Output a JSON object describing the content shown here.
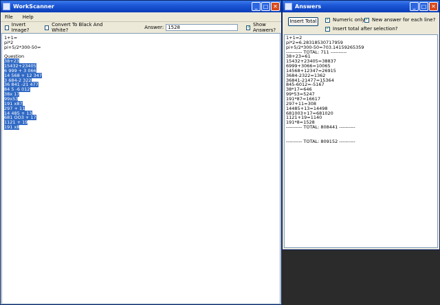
{
  "left_window": {
    "title": "WorkScanner",
    "menu": [
      "File",
      "Help"
    ],
    "toolbar": {
      "invert_image": "Invert Image?",
      "convert_bw": "Convert To Black And White?",
      "answer_label": "Answer:",
      "answer_value": "1528",
      "show_answers": "Show Answers?"
    },
    "text_lines": [
      "1+1=",
      "pi*2",
      "pi+5/2*300-50=",
      "",
      "Question",
      "38+23",
      "15432+23405",
      "6 999 + 3 066",
      "14 568 + 12 347",
      "3 684-2 322",
      "36 841 -21 477",
      "84 5 -6 012",
      "38x 17",
      "99x53",
      "191 x87",
      "297 + 11",
      "14 485 + 13",
      "681 OO3 + 17",
      "1121 + 19",
      "191 x8"
    ]
  },
  "right_window": {
    "title": "Answers",
    "insert_total": "Insert Total",
    "numeric_only": "Numeric only?",
    "new_answer": "New answer for each line?",
    "insert_after": "Insert total after selection?",
    "text_lines": [
      "1+1=2",
      "pi*2=6.28318530717959",
      "pi+5/2*300-50=703.14159265359",
      "---------- TOTAL: 711 ----------",
      "38+23=61",
      "15432+23405=38837",
      "6999+3066=10065",
      "14568+12347=26915",
      "3684-2322=1362",
      "36841-21477=15364",
      "845-6012=-5167",
      "38*17=646",
      "99*53=5247",
      "191*87=16617",
      "297+11=308",
      "14485+13=14498",
      "681003+17=681020",
      "1121+19=1140",
      "191*8=1528",
      "---------- TOTAL: 808441 ----------",
      "",
      "",
      "---------- TOTAL: 809152 ----------"
    ]
  }
}
